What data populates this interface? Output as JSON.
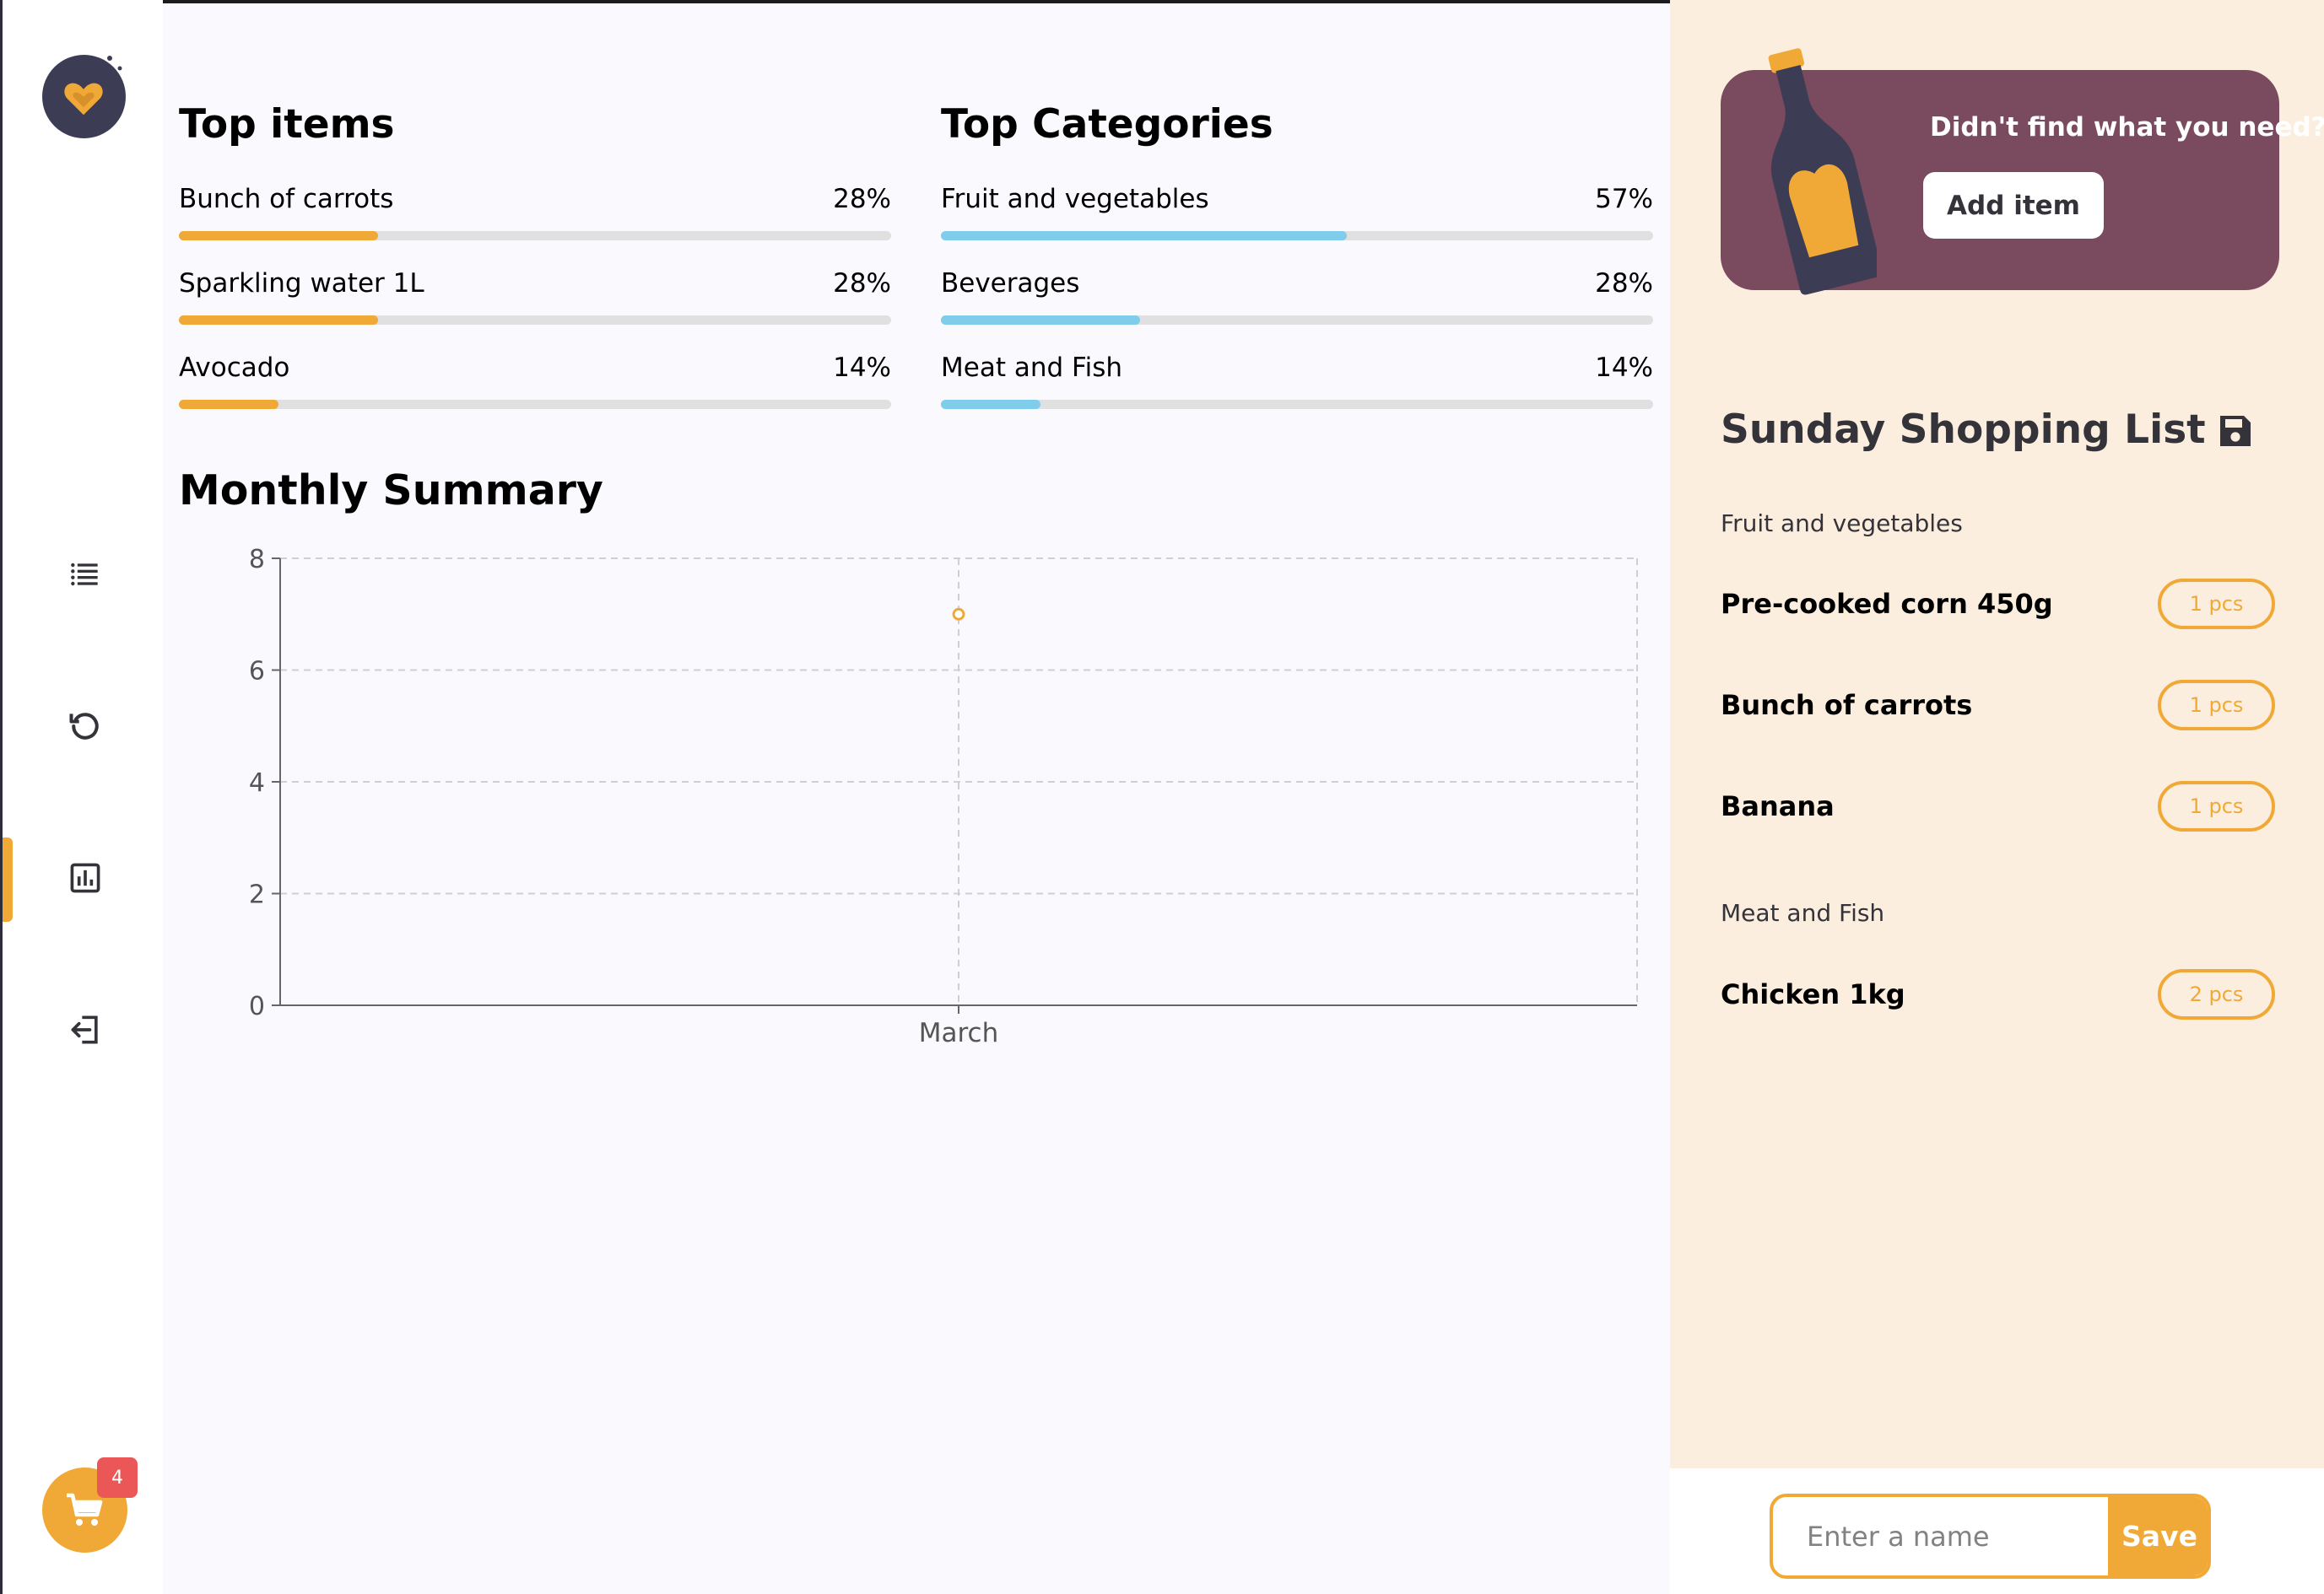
{
  "sidebar": {
    "logo_icon": "heart-logo-icon",
    "nav": [
      {
        "icon": "list-icon"
      },
      {
        "icon": "history-icon"
      },
      {
        "icon": "statistics-icon",
        "active": true
      },
      {
        "icon": "logout-icon"
      }
    ],
    "cart_badge": "4"
  },
  "top_items": {
    "title": "Top items",
    "rows": [
      {
        "name": "Bunch of carrots",
        "percent": "28%",
        "value": 28
      },
      {
        "name": "Sparkling water 1L",
        "percent": "28%",
        "value": 28
      },
      {
        "name": "Avocado",
        "percent": "14%",
        "value": 14
      }
    ]
  },
  "top_categories": {
    "title": "Top Categories",
    "rows": [
      {
        "name": "Fruit and vegetables",
        "percent": "57%",
        "value": 57
      },
      {
        "name": "Beverages",
        "percent": "28%",
        "value": 28
      },
      {
        "name": "Meat and Fish",
        "percent": "14%",
        "value": 14
      }
    ]
  },
  "monthly": {
    "title": "Monthly Summary"
  },
  "chart_data": {
    "type": "line",
    "title": "",
    "xlabel": "",
    "ylabel": "",
    "categories": [
      "March"
    ],
    "series": [
      {
        "values": [
          7
        ]
      }
    ],
    "ylim": [
      0,
      8
    ],
    "yticks": [
      "0",
      "2",
      "4",
      "6",
      "8"
    ],
    "grid": true,
    "color": "#F0A936"
  },
  "promo": {
    "question": "Didn't find what you need?",
    "button_label": "Add item"
  },
  "shopping_list": {
    "title": "Sunday Shopping List",
    "save_icon": "floppy-disk-icon",
    "categories": [
      {
        "name": "Fruit and vegetables",
        "items": [
          {
            "name": "Pre-cooked corn 450g",
            "qty": "1 pcs"
          },
          {
            "name": "Bunch of carrots",
            "qty": "1 pcs"
          },
          {
            "name": "Banana",
            "qty": "1 pcs"
          }
        ]
      },
      {
        "name": "Meat and Fish",
        "items": [
          {
            "name": "Chicken 1kg",
            "qty": "2 pcs"
          }
        ]
      }
    ]
  },
  "save_bar": {
    "placeholder": "Enter a name",
    "button_label": "Save"
  },
  "colors": {
    "accent": "#F0A936",
    "category_bar": "#7FCCEB",
    "promo_bg": "#7A4A5E",
    "panel_bg": "#FCEEDF",
    "badge": "#EB5757",
    "dark": "#3C3C55"
  }
}
